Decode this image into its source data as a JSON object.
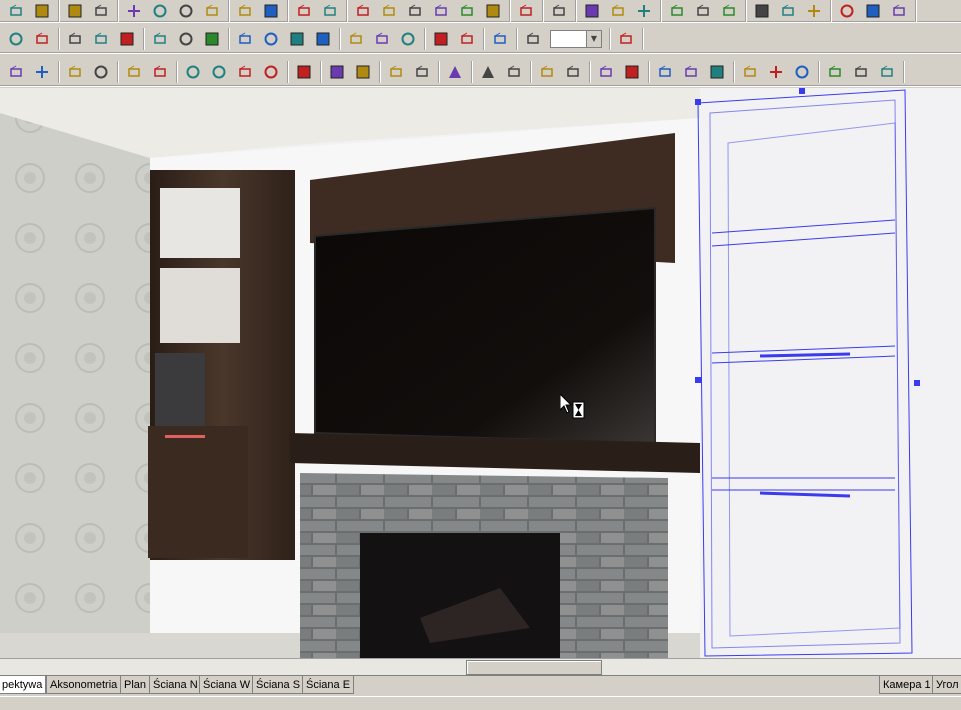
{
  "toolbar": {
    "row1": [
      [
        "save-icon",
        "properties-icon"
      ],
      [
        "print-icon",
        "print-preview-icon"
      ],
      [
        "cut-icon",
        "copy-icon",
        "paste-icon",
        "delete-icon"
      ],
      [
        "undo-icon",
        "redo-icon"
      ],
      [
        "settings-icon",
        "checklist-icon"
      ],
      [
        "calculator-icon",
        "zoom-page-icon",
        "fit-icon",
        "dimension-icon",
        "lightbulb-icon",
        "render-icon"
      ],
      [
        "sum-icon"
      ],
      [
        "mail-icon"
      ],
      [
        "align-left-icon",
        "align-center-icon",
        "align-right-icon"
      ],
      [
        "distribute-top-icon",
        "distribute-middle-icon",
        "distribute-bottom-icon"
      ],
      [
        "tool-a-icon",
        "tool-b-icon",
        "tool-c-icon"
      ],
      [
        "grid-a-icon",
        "grid-b-icon",
        "grid-c-icon"
      ]
    ],
    "row2": [
      [
        "cube-blue-icon",
        "cube-dark-icon"
      ],
      [
        "box-front-icon",
        "box-side-icon",
        "box-solid-icon"
      ],
      [
        "text-icon",
        "material-ball-icon",
        "light-icon"
      ],
      [
        "measure-icon",
        "ruler-icon",
        "grid-red-icon",
        "eye-icon"
      ],
      [
        "snap-point-icon",
        "snap-edge-icon",
        "snap-angle-icon"
      ],
      [
        "magnet-icon",
        "target-icon"
      ],
      [
        "target-red-icon"
      ],
      [
        "zoom-in-icon"
      ],
      [
        "zoom-out-icon"
      ]
    ],
    "zoom_value": "",
    "row3": [
      [
        "select-arrow-icon",
        "pen-icon"
      ],
      [
        "frame-icon",
        "group-icon"
      ],
      [
        "rotate-x-icon",
        "rotate-y-icon"
      ],
      [
        "rotate-icon",
        "move-icon",
        "mirror-icon",
        "scale-icon"
      ],
      [
        "offset-icon"
      ],
      [
        "hide-icon",
        "hide-other-icon"
      ],
      [
        "view-eye-icon",
        "view-eye2-icon"
      ],
      [
        "lifebuoy-icon"
      ],
      [
        "align-obj-left-icon",
        "align-obj-right-icon"
      ],
      [
        "align-obj-top-icon",
        "align-obj-bottom-icon"
      ],
      [
        "link-icon",
        "unlink-icon"
      ],
      [
        "dist-a-icon",
        "dist-b-icon",
        "dist-c-icon"
      ],
      [
        "dist-d-icon",
        "dist-e-icon",
        "dist-f-icon"
      ],
      [
        "layer-a-icon",
        "layer-b-icon",
        "layer-c-icon"
      ]
    ]
  },
  "tabs": {
    "perspective": "pektywa",
    "axonometry": "Aksonometria",
    "plan": "Plan",
    "wall_n": "Ściana N",
    "wall_w": "Ściana W",
    "wall_s": "Ściana S",
    "wall_e": "Ściana E",
    "camera": "Камера 1",
    "corner": "Угол"
  },
  "colors": {
    "toolbar_bg": "#d4d0c8",
    "selection_blue": "#3a3af0",
    "wood_dark": "#3a2a20",
    "tv_black": "#0e0a08",
    "stone_grey": "#6e7070"
  }
}
